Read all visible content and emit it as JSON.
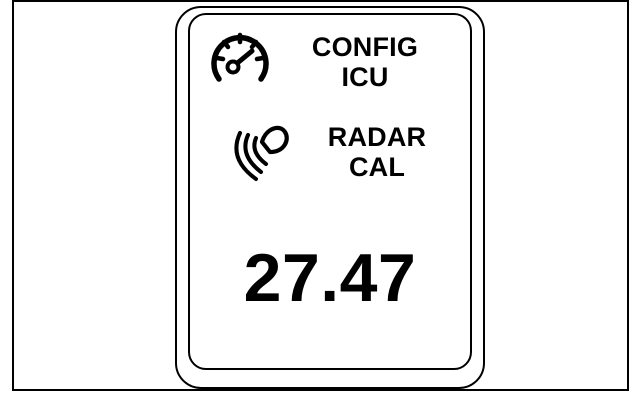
{
  "config_row": {
    "icon": "speedometer-icon",
    "line1": "CONFIG",
    "line2": "ICU"
  },
  "radar_row": {
    "icon": "radar-beam-icon",
    "line1": "RADAR",
    "line2": "CAL"
  },
  "readout": {
    "value": "27.47"
  }
}
